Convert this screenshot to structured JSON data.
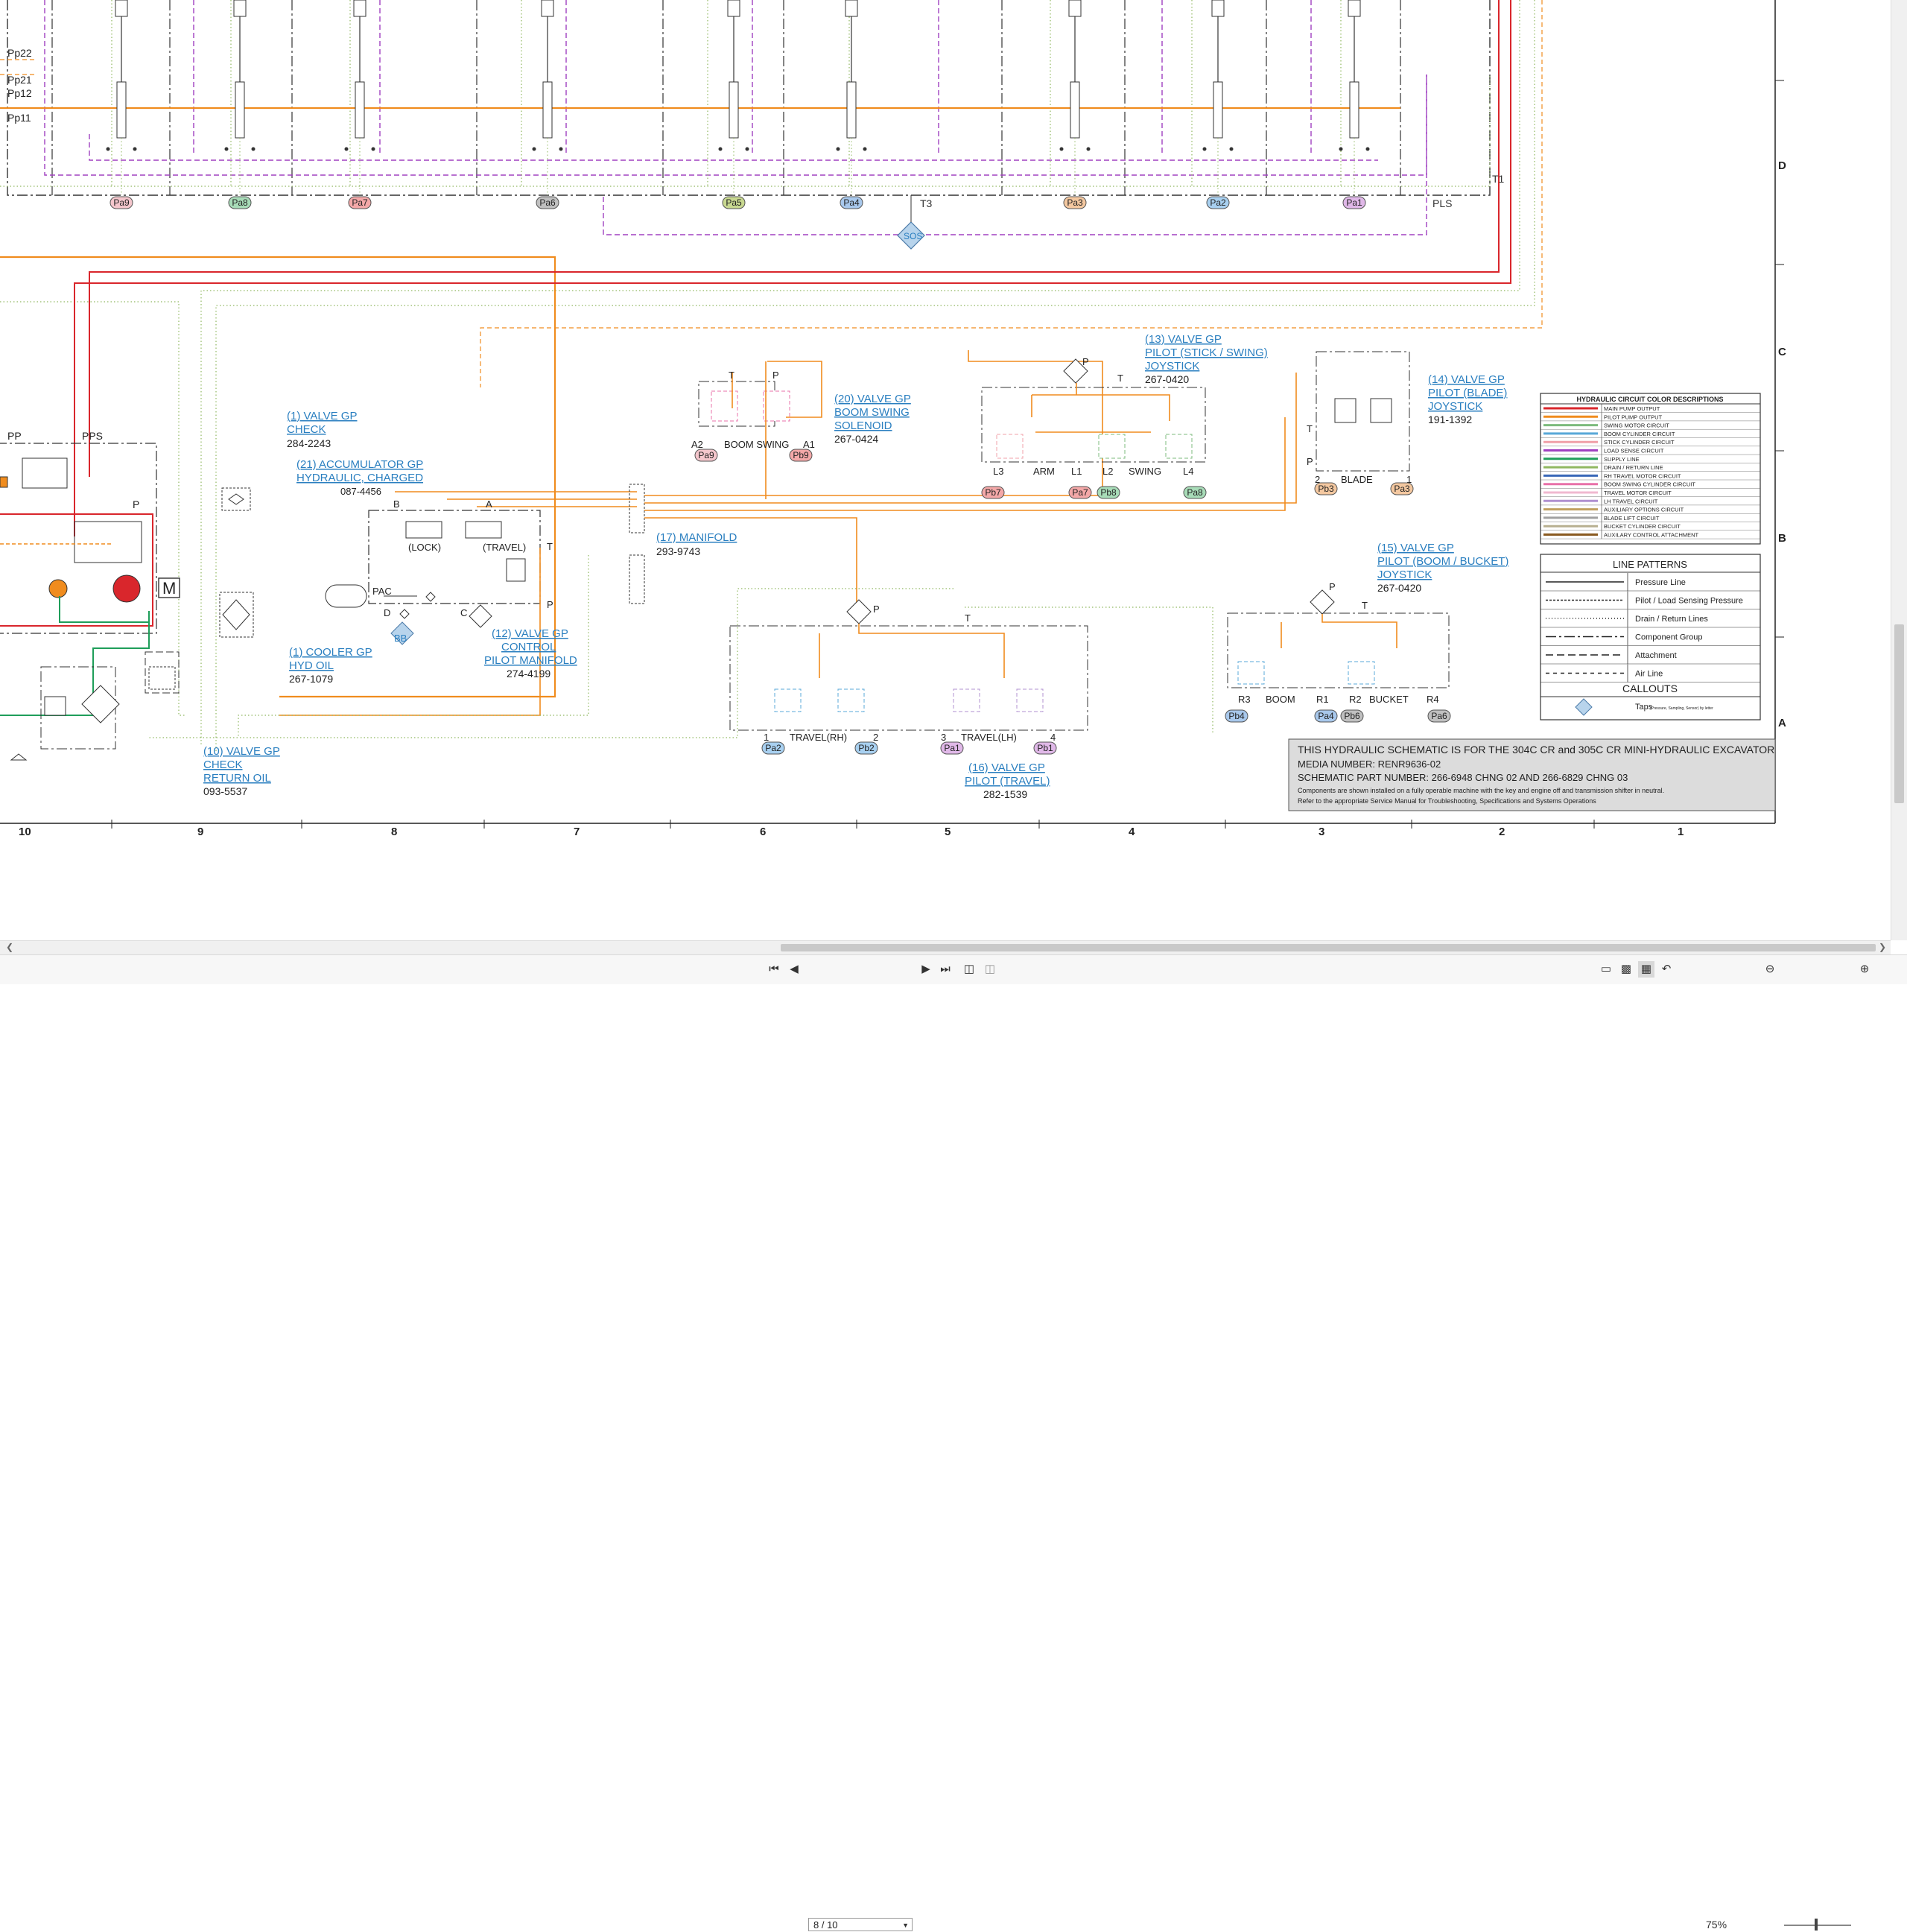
{
  "sheet": {
    "row_labels": [
      "D",
      "C",
      "B",
      "A"
    ],
    "col_labels": [
      "10",
      "9",
      "8",
      "7",
      "6",
      "5",
      "4",
      "3",
      "2",
      "1"
    ],
    "top_taps": [
      {
        "label": "Pa9",
        "color": "#f4c6cc"
      },
      {
        "label": "Pa8",
        "color": "#a8dcb8"
      },
      {
        "label": "Pa7",
        "color": "#f4a8a8"
      },
      {
        "label": "Pa6",
        "color": "#c0c0c0"
      },
      {
        "label": "Pa5",
        "color": "#c8d890"
      },
      {
        "label": "Pa4",
        "color": "#a8c8ec"
      },
      {
        "label": "Pa3",
        "color": "#f4c8a0"
      },
      {
        "label": "Pa2",
        "color": "#a8d0f0"
      },
      {
        "label": "Pa1",
        "color": "#e0b8e8"
      }
    ],
    "top_labels": {
      "t3": "T3",
      "pls": "PLS",
      "t1": "T1",
      "sos": "SOS",
      "pp22": "Pp22",
      "pp21": "Pp21",
      "pp12": "Pp12",
      "pp11": "Pp11",
      "pp": "PP",
      "pps": "PPS",
      "p": "P",
      "m": "M"
    }
  },
  "components": {
    "c1_check": {
      "line1": "(1) VALVE GP",
      "line2": "CHECK",
      "part": "284-2243"
    },
    "c21_accum": {
      "line1": "(21) ACCUMULATOR GP",
      "line2": "HYDRAULIC, CHARGED",
      "part": "087-4456"
    },
    "c1_cooler": {
      "line1": "(1) COOLER GP",
      "line2": "HYD OIL",
      "part": "267-1079"
    },
    "c12_manifold": {
      "line1": "(12) VALVE GP",
      "line2": "CONTROL",
      "line3": "PILOT MANIFOLD",
      "part": "274-4199",
      "lock": "(LOCK)",
      "travel": "(TRAVEL)",
      "pac": "PAC",
      "bb": "BB",
      "b": "B",
      "a": "A",
      "d": "D",
      "c": "C",
      "t": "T",
      "p": "P"
    },
    "c10_check": {
      "line1": "(10) VALVE GP",
      "line2": "CHECK",
      "line3": "RETURN OIL",
      "part": "093-5537"
    },
    "c20_solenoid": {
      "line1": "(20) VALVE GP",
      "line2": "BOOM SWING",
      "line3": "SOLENOID",
      "part": "267-0424",
      "name": "BOOM SWING",
      "a2": "A2",
      "a1": "A1",
      "t": "T",
      "p": "P",
      "tap1": "Pa9",
      "tap2": "Pb9"
    },
    "c17_manifold": {
      "line1": "(17) MANIFOLD",
      "part": "293-9743"
    },
    "c13_joystick": {
      "line1": "(13) VALVE GP",
      "line2": "PILOT (STICK / SWING)",
      "line3": "JOYSTICK",
      "part": "267-0420",
      "arm": "ARM",
      "swing": "SWING",
      "l3": "L3",
      "l1": "L1",
      "l2": "L2",
      "l4": "L4",
      "p": "P",
      "t": "T",
      "taps": [
        "Pb7",
        "Pa7",
        "Pb8",
        "Pa8"
      ]
    },
    "c14_blade": {
      "line1": "(14) VALVE GP",
      "line2": "PILOT (BLADE)",
      "line3": "JOYSTICK",
      "part": "191-1392",
      "name": "BLADE",
      "n2": "2",
      "n1": "1",
      "t": "T",
      "p": "P",
      "taps": [
        "Pb3",
        "Pa3"
      ]
    },
    "c15_joystick": {
      "line1": "(15) VALVE GP",
      "line2": "PILOT (BOOM / BUCKET)",
      "line3": "JOYSTICK",
      "part": "267-0420",
      "boom": "BOOM",
      "bucket": "BUCKET",
      "r3": "R3",
      "r1": "R1",
      "r2": "R2",
      "r4": "R4",
      "p": "P",
      "t": "T",
      "taps": [
        "Pb4",
        "Pa4",
        "Pb6",
        "Pa6"
      ]
    },
    "c16_travel": {
      "line1": "(16) VALVE GP",
      "line2": "PILOT (TRAVEL)",
      "part": "282-1539",
      "rh": "TRAVEL(RH)",
      "lh": "TRAVEL(LH)",
      "n1": "1",
      "n2": "2",
      "n3": "3",
      "n4": "4",
      "p": "P",
      "t": "T",
      "taps": [
        "Pa2",
        "Pb2",
        "Pa1",
        "Pb1"
      ]
    }
  },
  "color_legend": {
    "title": "HYDRAULIC CIRCUIT COLOR DESCRIPTIONS",
    "items": [
      {
        "label": "MAIN PUMP OUTPUT",
        "color": "#d9262c"
      },
      {
        "label": "PILOT PUMP OUTPUT",
        "color": "#f08c1e"
      },
      {
        "label": "SWING MOTOR CIRCUIT",
        "color": "#7dbb7d"
      },
      {
        "label": "BOOM CYLINDER CIRCUIT",
        "color": "#58a8d8"
      },
      {
        "label": "STICK CYLINDER CIRCUIT",
        "color": "#f0a0a8"
      },
      {
        "label": "LOAD SENSE CIRCUIT",
        "color": "#a040c0"
      },
      {
        "label": "SUPPLY LINE",
        "color": "#1f9e5a"
      },
      {
        "label": "DRAIN / RETURN LINE",
        "color": "#90b860"
      },
      {
        "label": "RH TRAVEL MOTOR CIRCUIT",
        "color": "#3a68b8"
      },
      {
        "label": "BOOM SWING CYLINDER CIRCUIT",
        "color": "#e870a8"
      },
      {
        "label": "TRAVEL MOTOR CIRCUIT",
        "color": "#f0b8d0"
      },
      {
        "label": "LH TRAVEL CIRCUIT",
        "color": "#b090d0"
      },
      {
        "label": "AUXILIARY OPTIONS CIRCUIT",
        "color": "#c0a060"
      },
      {
        "label": "BLADE LIFT CIRCUIT",
        "color": "#a0a0a0"
      },
      {
        "label": "BUCKET CYLINDER CIRCUIT",
        "color": "#b8b090"
      },
      {
        "label": "AUXILARY CONTROL ATTACHMENT",
        "color": "#8a5a20"
      }
    ]
  },
  "line_patterns": {
    "title": "LINE PATTERNS",
    "items": [
      {
        "label": "Pressure Line",
        "dash": ""
      },
      {
        "label": "Pilot / Load Sensing Pressure",
        "dash": "3,2"
      },
      {
        "label": "Drain / Return Lines",
        "dash": "1,3"
      },
      {
        "label": "Component Group",
        "dash": "14,4,3,4"
      },
      {
        "label": "Attachment",
        "dash": "10,5"
      },
      {
        "label": "Air Line",
        "dash": "5,5"
      }
    ]
  },
  "callouts": {
    "title": "CALLOUTS",
    "taps_label": "Taps",
    "taps_note": "(Pressure, Sampling, Sensor) by letter"
  },
  "title_block": {
    "line1": "THIS HYDRAULIC SCHEMATIC IS FOR THE 304C CR and 305C CR MINI-HYDRAULIC EXCAVATOR",
    "line2": "MEDIA NUMBER: RENR9636-02",
    "line3": "SCHEMATIC PART NUMBER: 266-6948 CHNG 02 AND 266-6829 CHNG 03",
    "note1": "Components are shown installed on a fully operable machine with the key and engine off and transmission shifter in neutral.",
    "note2": "Refer to the appropriate Service Manual for Troubleshooting, Specifications and Systems Operations"
  },
  "viewer": {
    "page_field": "8 / 10",
    "zoom": "75%",
    "icons": [
      "first-page-icon",
      "prev-page-icon",
      "next-page-icon",
      "last-page-icon",
      "fit-page-icon",
      "fit-width-icon",
      "single-page-icon",
      "two-page-icon",
      "continuous-icon",
      "rotate-icon",
      "zoom-out-icon",
      "zoom-in-icon"
    ]
  }
}
